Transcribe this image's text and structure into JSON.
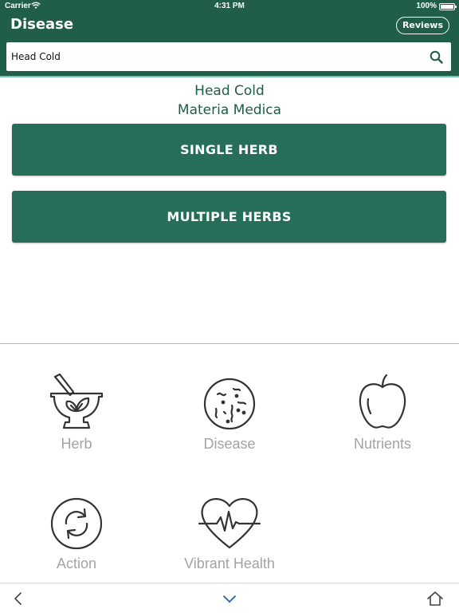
{
  "status_bar": {
    "carrier": "Carrier",
    "time": "4:31 PM",
    "battery": "100%"
  },
  "nav": {
    "title": "Disease",
    "reviews_label": "Reviews"
  },
  "search": {
    "value": "Head Cold",
    "icon": "search-icon"
  },
  "content": {
    "heading_line1": "Head Cold",
    "heading_line2": "Materia Medica",
    "buttons": [
      {
        "label": "SINGLE HERB"
      },
      {
        "label": "MULTIPLE HERBS"
      }
    ]
  },
  "categories": [
    {
      "label": "Herb",
      "icon": "mortar-pestle-icon"
    },
    {
      "label": "Disease",
      "icon": "germ-icon"
    },
    {
      "label": "Nutrients",
      "icon": "apple-icon"
    },
    {
      "label": "Action",
      "icon": "refresh-circle-icon"
    },
    {
      "label": "Vibrant Health",
      "icon": "heartbeat-icon"
    }
  ],
  "bottom_bar": {
    "back_icon": "chevron-left-icon",
    "down_icon": "chevron-down-icon",
    "home_icon": "home-icon"
  },
  "colors": {
    "primary": "#215e49",
    "button": "#266e59",
    "accent_line": "#7dc4ad",
    "heading_text": "#1f5c48",
    "category_label": "#a3a3a3"
  }
}
